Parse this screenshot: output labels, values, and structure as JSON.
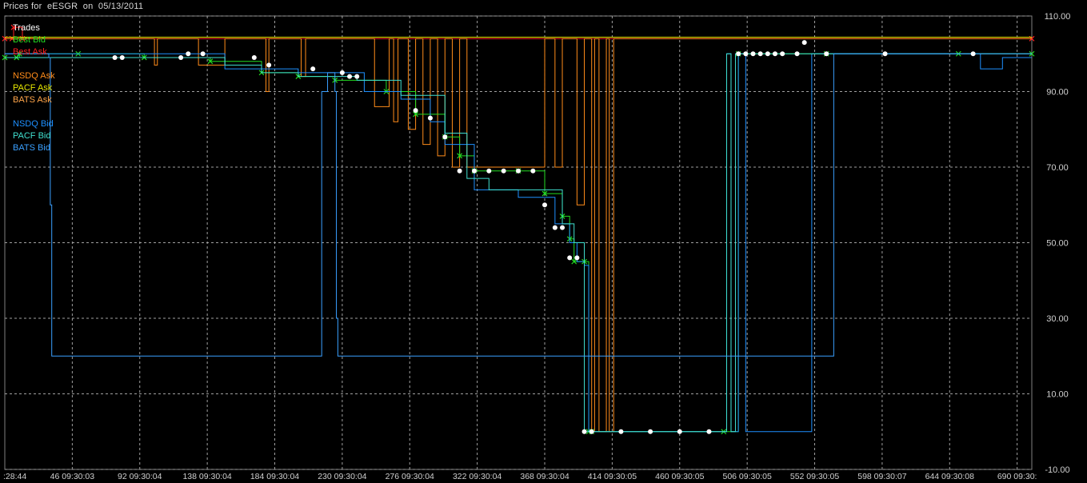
{
  "window": {
    "title": "Prices for  eESGR  on  05/13/2011"
  },
  "legend": [
    {
      "label": "Trades",
      "color": "#ffffff"
    },
    {
      "label": "Best Bid",
      "color": "#22dd22"
    },
    {
      "label": "Best Ask",
      "color": "#ff2020"
    },
    {
      "label": "NSDQ Ask",
      "color": "#ff8c1a"
    },
    {
      "label": "PACF Ask",
      "color": "#e6e600"
    },
    {
      "label": "BATS Ask",
      "color": "#ffa54a"
    },
    {
      "label": "NSDQ Bid",
      "color": "#1e90ff"
    },
    {
      "label": "PACF Bid",
      "color": "#40e0d0"
    },
    {
      "label": "BATS Bid",
      "color": "#3aa0ff"
    }
  ],
  "chart_data": {
    "type": "line",
    "title": "Prices for  eESGR  on  05/13/2011",
    "grid": true,
    "legend_position": "top-left",
    "ylim": [
      -10,
      110
    ],
    "xlim": [
      0,
      700
    ],
    "y_ticks": [
      "110.00",
      "90.00",
      "70.00",
      "50.00",
      "30.00",
      "10.00",
      "-10.00"
    ],
    "x_tick_labels": [
      ":28:44",
      "46 09:30:03",
      "92 09:30:04",
      "138 09:30:04",
      "184 09:30:04",
      "230 09:30:04",
      "276 09:30:04",
      "322 09:30:04",
      "368 09:30:04",
      "414 09:30:05",
      "460 09:30:05",
      "506 09:30:05",
      "552 09:30:05",
      "598 09:30:07",
      "644 09:30:08",
      "690 09:30:"
    ],
    "series": [
      {
        "name": "Best Ask",
        "color": "#ff2020",
        "kind": "line",
        "x": [
          0,
          5,
          6,
          12,
          700
        ],
        "y": [
          104,
          104,
          107,
          104,
          104
        ]
      },
      {
        "name": "NSDQ Ask",
        "color": "#ff8c1a",
        "kind": "line",
        "x": [
          0,
          100,
          102,
          104,
          130,
          132,
          150,
          160,
          175,
          178,
          180,
          200,
          202,
          205,
          250,
          252,
          262,
          265,
          268,
          275,
          280,
          285,
          290,
          295,
          300,
          305,
          310,
          315,
          320,
          335,
          360,
          368,
          375,
          380,
          390,
          395,
          400,
          402,
          405,
          410,
          412,
          415,
          420,
          700
        ],
        "y": [
          104,
          104,
          97,
          104,
          104,
          97,
          104,
          104,
          104,
          90,
          104,
          104,
          94,
          104,
          104,
          86,
          104,
          82,
          104,
          80,
          104,
          76,
          104,
          73,
          104,
          70,
          104,
          70,
          70,
          70,
          70,
          104,
          70,
          104,
          60,
          104,
          0,
          104,
          0,
          104,
          0,
          104,
          104,
          104
        ]
      },
      {
        "name": "PACF Ask",
        "color": "#e6e600",
        "kind": "line",
        "x": [
          0,
          700
        ],
        "y": [
          104.4,
          104.4
        ]
      },
      {
        "name": "Best Bid",
        "color": "#22dd22",
        "kind": "line",
        "x": [
          0,
          8,
          10,
          50,
          95,
          140,
          175,
          200,
          225,
          260,
          280,
          300,
          310,
          320,
          350,
          368,
          380,
          385,
          388,
          395,
          398,
          400,
          490,
          500,
          560,
          650,
          700
        ],
        "y": [
          99,
          99,
          100,
          100,
          99,
          98,
          95,
          94,
          93,
          90,
          84,
          78,
          73,
          69,
          69,
          63,
          57,
          51,
          45,
          45,
          0,
          0,
          0,
          100,
          100,
          100,
          100
        ]
      },
      {
        "name": "NSDQ Bid",
        "color": "#1e90ff",
        "kind": "line",
        "x": [
          0,
          140,
          150,
          175,
          200,
          215,
          245,
          270,
          290,
          300,
          320,
          350,
          368,
          375,
          385,
          390,
          395,
          398,
          400,
          490,
          492,
          495,
          500,
          505,
          550,
          560,
          660,
          665,
          680,
          700
        ],
        "y": [
          100,
          100,
          96,
          96,
          95,
          95,
          90,
          88,
          82,
          76,
          64,
          62,
          62,
          55,
          50,
          45,
          44,
          0,
          0,
          0,
          100,
          0,
          100,
          0,
          100,
          100,
          100,
          96,
          99,
          99
        ]
      },
      {
        "name": "PACF Bid",
        "color": "#40e0d0",
        "kind": "line",
        "x": [
          0,
          100,
          150,
          175,
          200,
          240,
          270,
          300,
          315,
          330,
          360,
          368,
          380,
          388,
          395,
          490,
          492,
          495,
          498,
          700
        ],
        "y": [
          99,
          99,
          97,
          95,
          94,
          93,
          89,
          79,
          67,
          64,
          64,
          64,
          55,
          50,
          0,
          0,
          100,
          0,
          100,
          100
        ]
      },
      {
        "name": "BATS Bid",
        "color": "#3aa0ff",
        "kind": "line",
        "x": [
          0,
          30,
          31,
          32,
          215,
          216,
          220,
          225,
          226,
          227,
          560,
          565,
          700
        ],
        "y": [
          100,
          99,
          60,
          20,
          20,
          90,
          95,
          90,
          30,
          20,
          20,
          100,
          100
        ]
      },
      {
        "name": "Trades",
        "color": "#ffffff",
        "kind": "markers",
        "x": [
          75,
          80,
          120,
          125,
          135,
          170,
          180,
          210,
          230,
          235,
          240,
          280,
          290,
          300,
          310,
          320,
          330,
          340,
          350,
          360,
          368,
          375,
          380,
          385,
          390,
          395,
          400,
          420,
          440,
          460,
          480,
          500,
          505,
          510,
          515,
          520,
          525,
          530,
          540,
          545,
          560,
          600,
          660
        ],
        "y": [
          99,
          99,
          99,
          100,
          100,
          99,
          97,
          96,
          95,
          94,
          94,
          85,
          83,
          78,
          69,
          69,
          69,
          69,
          69,
          69,
          60,
          54,
          54,
          46,
          46,
          0,
          0,
          0,
          0,
          0,
          0,
          100,
          100,
          100,
          100,
          100,
          100,
          100,
          100,
          103,
          100,
          100,
          100
        ]
      }
    ]
  }
}
